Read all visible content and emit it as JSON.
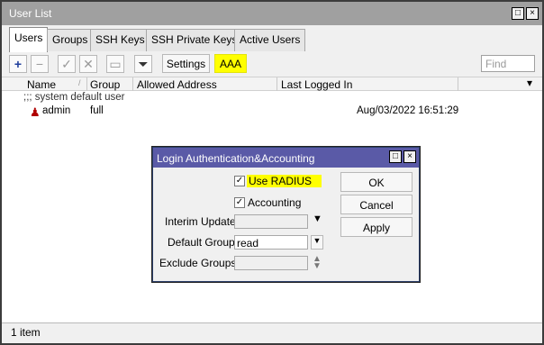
{
  "window": {
    "title": "User List",
    "tabs": [
      "Users",
      "Groups",
      "SSH Keys",
      "SSH Private Keys",
      "Active Users"
    ],
    "toolbar": {
      "settings_label": "Settings",
      "aaa_label": "AAA",
      "find_placeholder": "Find"
    },
    "columns": [
      "Name",
      "Group",
      "Allowed Address",
      "Last Logged In"
    ],
    "rows": [
      {
        "comment": ";;; system default user"
      },
      {
        "name": "admin",
        "group": "full",
        "allowed_address": "",
        "last_logged_in": "Aug/03/2022 16:51:29"
      }
    ],
    "status": "1 item"
  },
  "dialog": {
    "title": "Login Authentication&Accounting",
    "use_radius_label": "Use RADIUS",
    "accounting_label": "Accounting",
    "interim_update_label": "Interim Update:",
    "default_group_label": "Default Group:",
    "default_group_value": "read",
    "exclude_groups_label": "Exclude Groups:",
    "ok_label": "OK",
    "cancel_label": "Cancel",
    "apply_label": "Apply"
  }
}
